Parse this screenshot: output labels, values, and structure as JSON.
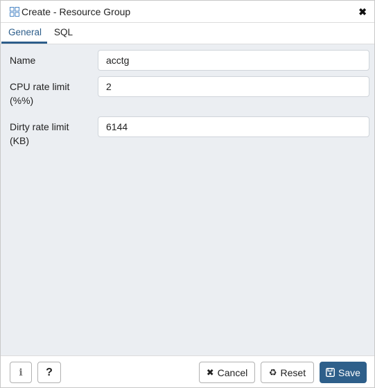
{
  "window": {
    "title": "Create - Resource Group",
    "close_icon": "close-icon",
    "title_icon": "resource-group-icon"
  },
  "tabs": [
    {
      "label": "General",
      "active": true
    },
    {
      "label": "SQL",
      "active": false
    }
  ],
  "form": {
    "name": {
      "label": "Name",
      "value": "acctg"
    },
    "cpu_rate_limit": {
      "label_line1": "CPU rate limit",
      "label_line2": "(%%)",
      "value": "2"
    },
    "dirty_rate_limit": {
      "label_line1": "Dirty rate limit",
      "label_line2": "(KB)",
      "value": "6144"
    }
  },
  "footer": {
    "info_label": "i",
    "help_label": "?",
    "cancel_label": "Cancel",
    "reset_label": "Reset",
    "save_label": "Save"
  },
  "colors": {
    "accent": "#2e5f8a",
    "content_bg": "#ebeef2"
  }
}
